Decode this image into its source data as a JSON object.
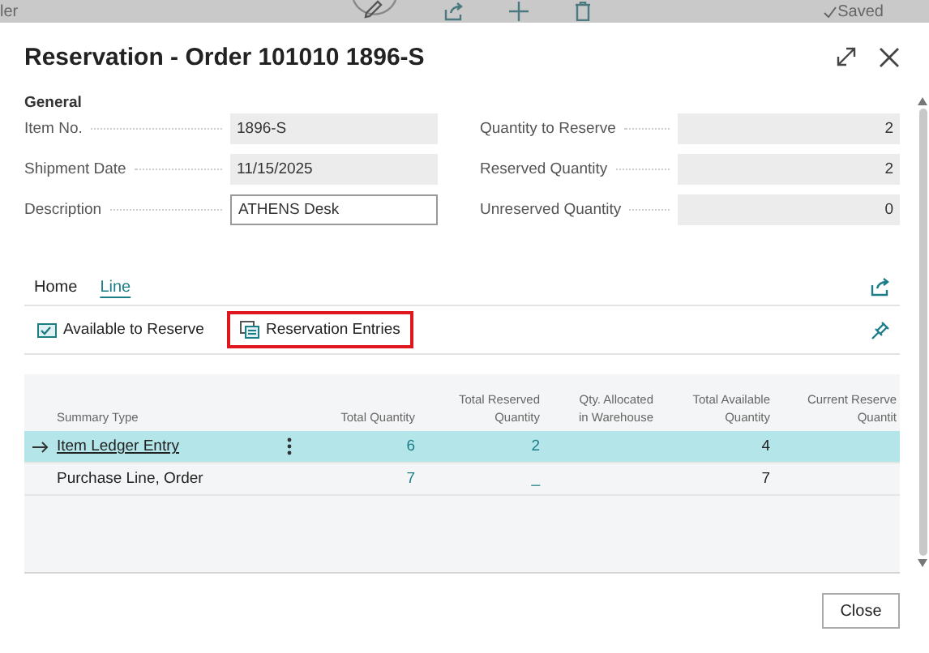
{
  "top_bar": {
    "left_text": "ler",
    "status": "Saved"
  },
  "dialog": {
    "title": "Reservation - Order 101010 1896-S",
    "section": "General",
    "fields_left": [
      {
        "label": "Item No.",
        "value": "1896-S",
        "editable": false
      },
      {
        "label": "Shipment Date",
        "value": "11/15/2025",
        "editable": false
      },
      {
        "label": "Description",
        "value": "ATHENS Desk",
        "editable": true
      }
    ],
    "fields_right": [
      {
        "label": "Quantity to Reserve",
        "value": "2",
        "editable": false
      },
      {
        "label": "Reserved Quantity",
        "value": "2",
        "editable": false
      },
      {
        "label": "Unreserved Quantity",
        "value": "0",
        "editable": false
      }
    ],
    "tabs": [
      {
        "label": "Home",
        "selected": false
      },
      {
        "label": "Line",
        "selected": true
      }
    ],
    "actions": [
      {
        "label": "Available to Reserve",
        "kind": "available",
        "highlighted": false
      },
      {
        "label": "Reservation Entries",
        "kind": "entries",
        "highlighted": true
      }
    ],
    "table": {
      "columns": [
        {
          "lines": [
            "Summary Type"
          ]
        },
        {
          "lines": [
            "Total Quantity"
          ]
        },
        {
          "lines": [
            "Total Reserved",
            "Quantity"
          ]
        },
        {
          "lines": [
            "Qty. Allocated",
            "in Warehouse"
          ]
        },
        {
          "lines": [
            "Total Available",
            "Quantity"
          ]
        },
        {
          "lines": [
            "Current Reserve",
            "Quantit"
          ]
        }
      ],
      "rows": [
        {
          "selected": true,
          "link": true,
          "summary_type": "Item Ledger Entry",
          "total_quantity": "6",
          "total_reserved": "2",
          "total_available": "4"
        },
        {
          "selected": false,
          "link": false,
          "summary_type": "Purchase Line, Order",
          "total_quantity": "7",
          "total_reserved": "_",
          "total_available": "7"
        }
      ]
    },
    "buttons": [
      "Close"
    ]
  }
}
